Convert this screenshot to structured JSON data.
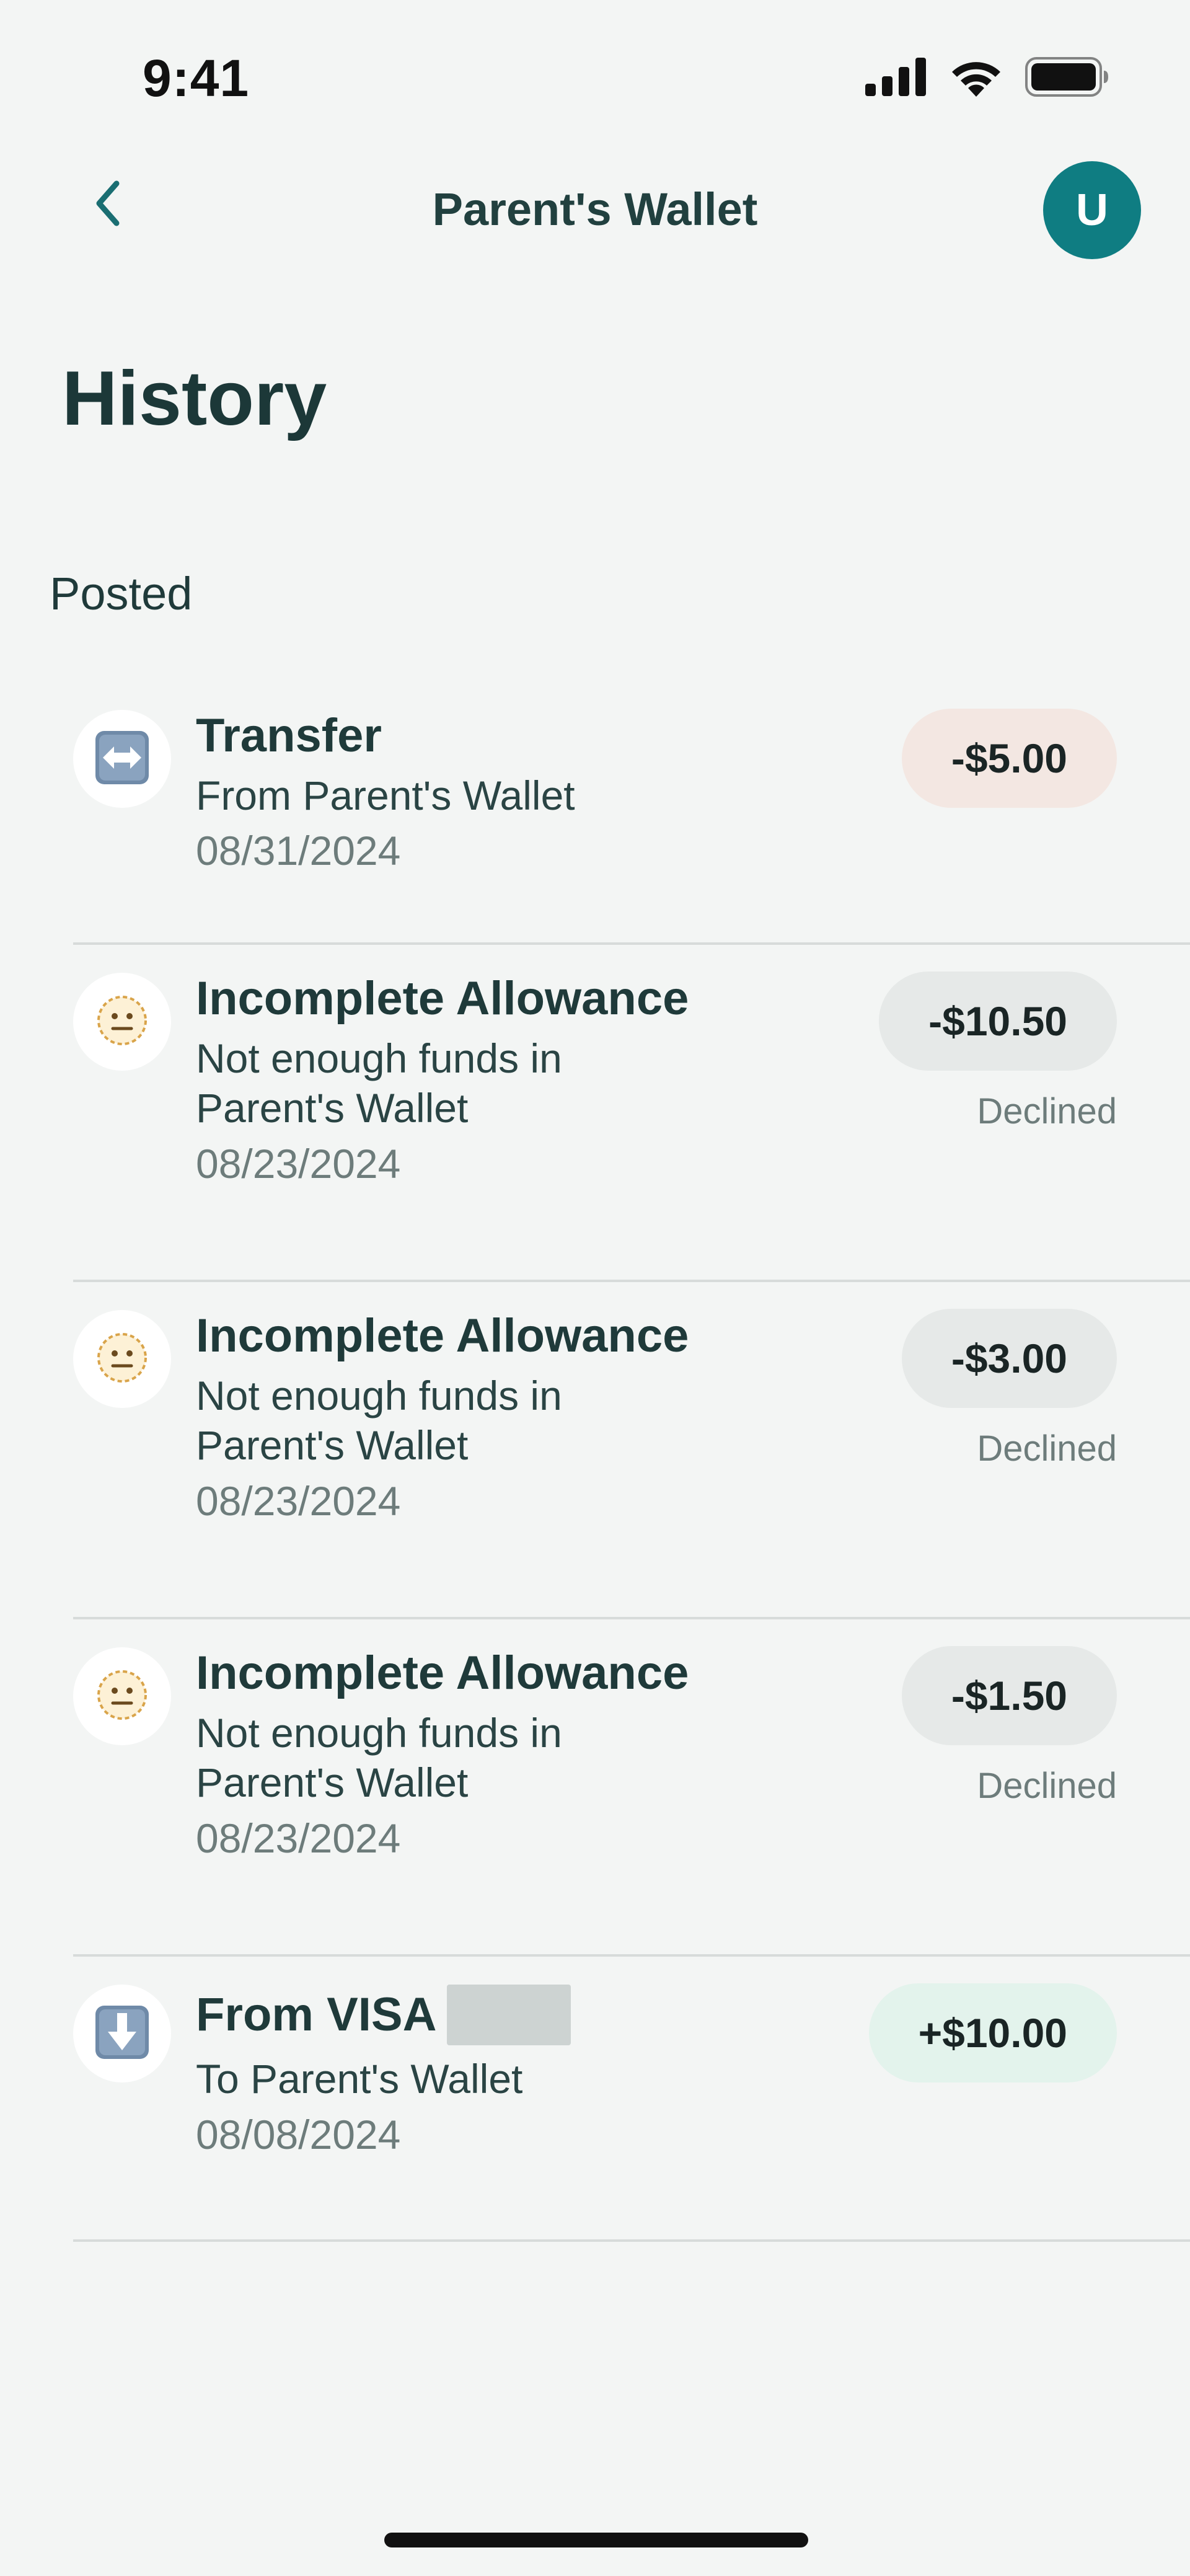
{
  "status_bar": {
    "time": "9:41",
    "icons": [
      "cellular-signal-icon",
      "wifi-icon",
      "battery-icon"
    ]
  },
  "header": {
    "back_icon": "chevron-left-icon",
    "title": "Parent's Wallet",
    "avatar_initial": "U",
    "avatar_color": "#0f7d82"
  },
  "page_title": "History",
  "section": {
    "title": "Posted"
  },
  "transactions": [
    {
      "icon": "left-right-arrow-icon",
      "title": "Transfer",
      "subtitle": "From Parent's Wallet",
      "date": "08/31/2024",
      "amount": "-$5.00",
      "status": ""
    },
    {
      "icon": "neutral-face-icon",
      "title": "Incomplete Allowance",
      "subtitle": "Not enough funds in Parent's Wallet",
      "date": "08/23/2024",
      "amount": "-$10.50",
      "status": "Declined"
    },
    {
      "icon": "neutral-face-icon",
      "title": "Incomplete Allowance",
      "subtitle": "Not enough funds in Parent's Wallet",
      "date": "08/23/2024",
      "amount": "-$3.00",
      "status": "Declined"
    },
    {
      "icon": "neutral-face-icon",
      "title": "Incomplete Allowance",
      "subtitle": "Not enough funds in Parent's Wallet",
      "date": "08/23/2024",
      "amount": "-$1.50",
      "status": "Declined"
    },
    {
      "icon": "down-arrow-icon",
      "title": "From VISA",
      "subtitle": "To Parent's Wallet",
      "date": "08/08/2024",
      "amount": "+$10.00",
      "status": ""
    }
  ],
  "colors": {
    "background": "#f3f5f4",
    "debit_pill": "#f3e7e2",
    "declined_pill": "#e6e9e8",
    "credit_pill": "#e3f3ec",
    "accent": "#0f7d82"
  }
}
